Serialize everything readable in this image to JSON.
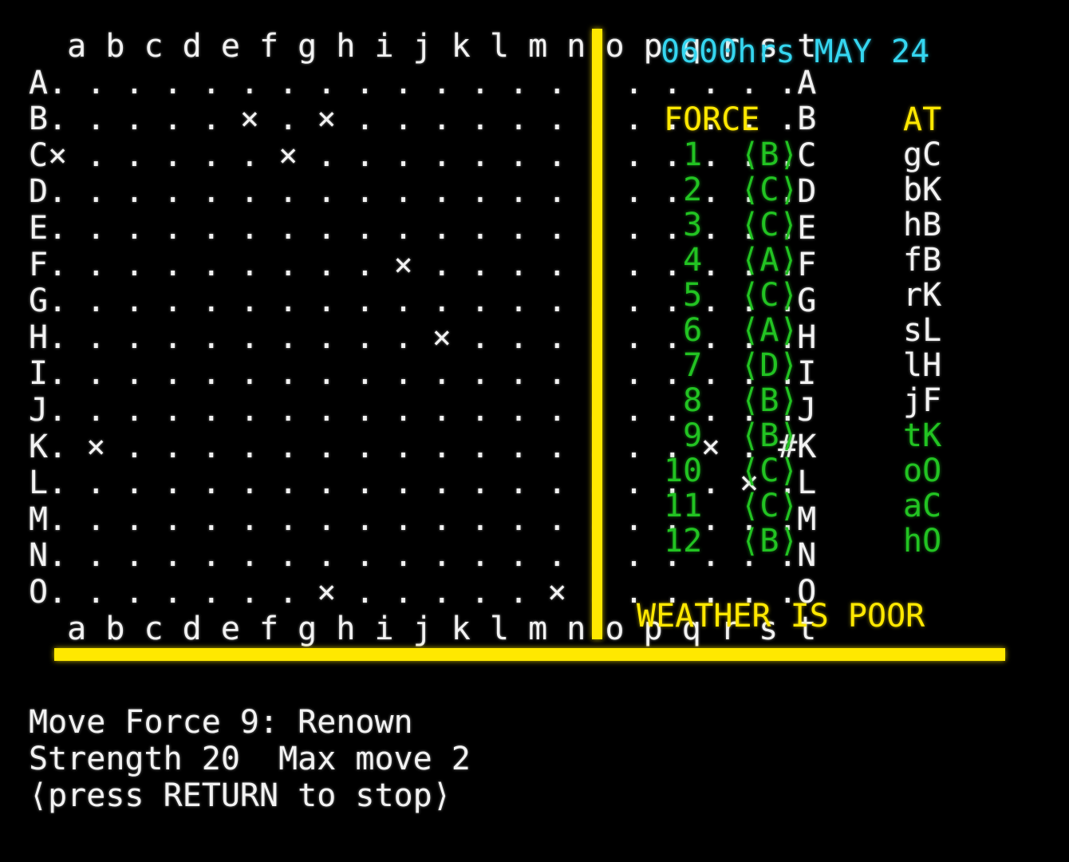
{
  "screen": {
    "background": "#000000",
    "text_color": "#f2f2f2",
    "accent_yellow": "#ffe800",
    "accent_cyan": "#35d6f0",
    "accent_green": "#22c322"
  },
  "map": {
    "column_labels_top": "  a b c d e f g h i j k l m n o p q r s t",
    "column_labels_bottom": "  a b c d e f g h i j k l m n o p q r s t",
    "row_labels": [
      "A",
      "B",
      "C",
      "D",
      "E",
      "F",
      "G",
      "H",
      "I",
      "J",
      "K",
      "L",
      "M",
      "N",
      "O"
    ],
    "columns": [
      "a",
      "b",
      "c",
      "d",
      "e",
      "f",
      "g",
      "h",
      "i",
      "j",
      "k",
      "l",
      "m",
      "n",
      "o",
      "p",
      "q",
      "r",
      "s",
      "t"
    ],
    "empty_cell": ".",
    "unit_marker": "×",
    "port_marker": "#",
    "rows": [
      {
        "label": "A",
        "cells": ". . . . . . . . . . . . . . . . . . . ."
      },
      {
        "label": "B",
        "cells": ". . . . . × . × . . . . . . . . . . . ."
      },
      {
        "label": "C",
        "cells": "× . . . . . × . . . . . . . . . . . . ."
      },
      {
        "label": "D",
        "cells": ". . . . . . . . . . . . . . . . . . . ."
      },
      {
        "label": "E",
        "cells": ". . . . . . . . . . . . . . . . . . . ."
      },
      {
        "label": "F",
        "cells": ". . . . . . . . . × . . . . . . . . . ."
      },
      {
        "label": "G",
        "cells": ". . . . . . . . . . . . . . . . . . . ."
      },
      {
        "label": "H",
        "cells": ". . . . . . . . . . × . . . . . . . . ."
      },
      {
        "label": "I",
        "cells": ". . . . . . . . . . . . . . . . . . . ."
      },
      {
        "label": "J",
        "cells": ". . . . . . . . . . . . . . . . . . . ."
      },
      {
        "label": "K",
        "cells": ". × . . . . . . . . . . . . . . . × . #"
      },
      {
        "label": "L",
        "cells": ". . . . . . . . . . . . . . . . . . × ."
      },
      {
        "label": "M",
        "cells": ". . . . . . . . . . . . . . . . . . . ."
      },
      {
        "label": "N",
        "cells": ". . . . . . . . . . . . . . . . . . . ."
      },
      {
        "label": "O",
        "cells": ". . . . . . . × . . . . . × . . . . . ."
      }
    ]
  },
  "status": {
    "datetime": "0600hrs MAY 24",
    "table": {
      "header_force": "FORCE",
      "header_at": "AT",
      "rows": [
        {
          "id": "1",
          "force": " 1  ⟨B⟩",
          "at": "gC",
          "at_highlight": false
        },
        {
          "id": "2",
          "force": " 2  ⟨C⟩",
          "at": "bK",
          "at_highlight": false
        },
        {
          "id": "3",
          "force": " 3  ⟨C⟩",
          "at": "hB",
          "at_highlight": false
        },
        {
          "id": "4",
          "force": " 4  ⟨A⟩",
          "at": "fB",
          "at_highlight": false
        },
        {
          "id": "5",
          "force": " 5  ⟨C⟩",
          "at": "rK",
          "at_highlight": false
        },
        {
          "id": "6",
          "force": " 6  ⟨A⟩",
          "at": "sL",
          "at_highlight": false
        },
        {
          "id": "7",
          "force": " 7  ⟨D⟩",
          "at": "lH",
          "at_highlight": false
        },
        {
          "id": "8",
          "force": " 8  ⟨B⟩",
          "at": "jF",
          "at_highlight": false
        },
        {
          "id": "9",
          "force": " 9  ⟨B⟩",
          "at": "tK",
          "at_highlight": true
        },
        {
          "id": "10",
          "force": "10  ⟨C⟩",
          "at": "oO",
          "at_highlight": true
        },
        {
          "id": "11",
          "force": "11  ⟨C⟩",
          "at": "aC",
          "at_highlight": true
        },
        {
          "id": "12",
          "force": "12  ⟨B⟩",
          "at": "hO",
          "at_highlight": true
        }
      ]
    },
    "weather": "WEATHER IS POOR"
  },
  "prompt": {
    "line1": "Move Force 9: Renown",
    "line2": "Strength 20  Max move 2",
    "line3": "⟨press RETURN to stop⟩"
  }
}
